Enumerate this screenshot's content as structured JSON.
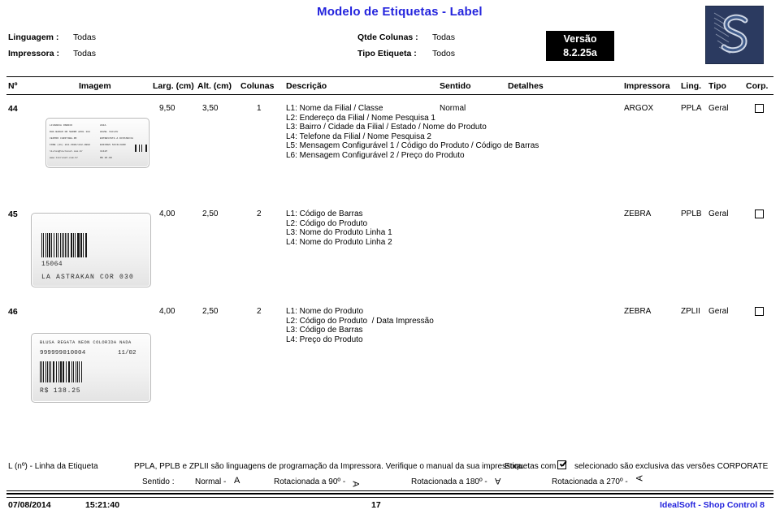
{
  "header": {
    "title": "Modelo de Etiquetas - Label",
    "params_left": [
      {
        "label": "Linguagem :",
        "value": "Todas"
      },
      {
        "label": "Impressora :",
        "value": "Todas"
      }
    ],
    "params_right": [
      {
        "label": "Qtde Colunas :",
        "value": "Todas"
      },
      {
        "label": "Tipo Etiqueta :",
        "value": "Todos"
      }
    ],
    "version_caption": "Versão",
    "version_number": "8.2.25a",
    "logo_name": "idealsoft-logo"
  },
  "table": {
    "columns": [
      {
        "key": "numero",
        "label": "Nº"
      },
      {
        "key": "imagem",
        "label": "Imagem"
      },
      {
        "key": "largura",
        "label": "Larg. (cm)"
      },
      {
        "key": "altura",
        "label": "Alt. (cm)"
      },
      {
        "key": "colunas",
        "label": "Colunas"
      },
      {
        "key": "descricao",
        "label": "Descrição"
      },
      {
        "key": "sentido",
        "label": "Sentido"
      },
      {
        "key": "detalhes",
        "label": "Detalhes"
      },
      {
        "key": "impressora",
        "label": "Impressora"
      },
      {
        "key": "ling",
        "label": "Ling."
      },
      {
        "key": "tipo",
        "label": "Tipo"
      },
      {
        "key": "corp",
        "label": "Corp."
      }
    ],
    "rows": [
      {
        "numero": "44",
        "largura": "9,50",
        "altura": "3,50",
        "colunas": "1",
        "descricao": "L1: Nome da Filial / Classe\nL2: Endereço da Filial / Nome Pesquisa 1\nL3: Bairro / Cidade da Filial / Estado / Nome do Produto\nL4: Telefone da Filial / Nome Pesquisa 2\nL5: Mensagem Configurável 1 / Código do Produto / Código de Barras\nL6: Mensagem Configurável 2 / Preço do Produto",
        "sentido": "Normal",
        "detalhes": "",
        "impressora": "ARGOX",
        "ling": "PPLA",
        "tipo": "Geral",
        "corp_checked": false,
        "label_preview": {
          "lines_left": [
            "LIVRARIA OSORIO",
            "RUA BARAO DO SERRO AZUL 181",
            "CENTRO  CURITIBA-PR",
            "FONE  (41) 224-3904/222-0802",
            "livros@livronet.com.br",
            "www.livronet.com.br"
          ],
          "lines_right": [
            "ASIA",
            "HAVEL   VACLAV",
            "ENTREVISTA A DISTANCIA",
            "EDICOES SICILIANO",
            "11187",
            "R$ 26.00"
          ]
        }
      },
      {
        "numero": "45",
        "largura": "4,00",
        "altura": "2,50",
        "colunas": "2",
        "descricao": "L1: Código de Barras\nL2: Código do Produto\nL3: Nome do Produto Linha 1\nL4: Nome do Produto Linha 2",
        "sentido": "",
        "detalhes": "",
        "impressora": "ZEBRA",
        "ling": "PPLB",
        "tipo": "Geral",
        "corp_checked": false,
        "label_preview": {
          "code": "15064",
          "name": "LA ASTRAKAN COR 030"
        }
      },
      {
        "numero": "46",
        "largura": "4,00",
        "altura": "2,50",
        "colunas": "2",
        "descricao": "L1: Nome do Produto\nL2: Código do Produto  / Data Impressão\nL3: Código de Barras\nL4: Preço do Produto",
        "sentido": "",
        "detalhes": "",
        "impressora": "ZEBRA",
        "ling": "ZPLII",
        "tipo": "Geral",
        "corp_checked": false,
        "label_preview": {
          "name": "BLUSA REGATA NEON COLORIDA NADA",
          "code": "999999010004",
          "date": "11/02",
          "price": "R$ 138.25"
        }
      }
    ]
  },
  "footer": {
    "legend_line": "L (nº) - Linha da Etiqueta",
    "note": "PPLA, PPLB e ZPLII são linguagens de programação da Impressora. Verifique o manual da sua impressora.",
    "corporate_prefix": "Etiquetas com",
    "corporate_suffix": "selecionado são exclusiva das versões CORPORATE",
    "sentido_label": "Sentido :",
    "orientations": [
      {
        "label": "Normal -",
        "glyph": "A",
        "rotation": 0
      },
      {
        "label": "Rotacionada a 90º -",
        "glyph": "A",
        "rotation": 90
      },
      {
        "label": "Rotacionada a 180º -",
        "glyph": "A",
        "rotation": 180
      },
      {
        "label": "Rotacionada a 270º -",
        "glyph": "A",
        "rotation": 270
      }
    ],
    "date": "07/08/2014",
    "time": "15:21:40",
    "page": "17",
    "brand": "IdealSoft - Shop Control 8"
  }
}
